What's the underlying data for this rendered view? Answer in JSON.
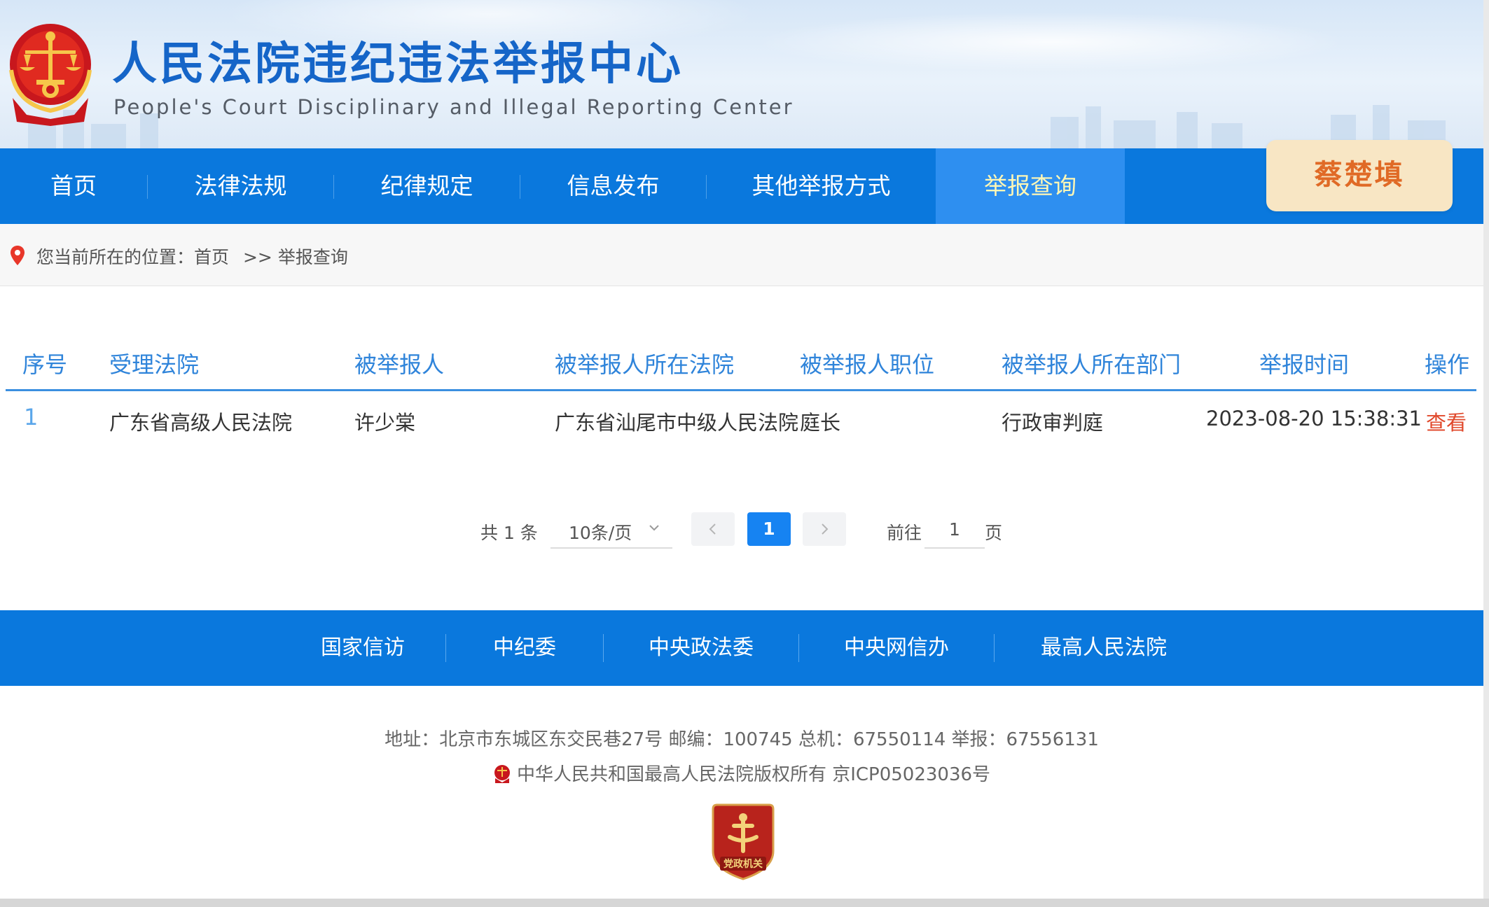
{
  "header": {
    "title_cn": "人民法院违纪违法举报中心",
    "title_en": "People's Court Disciplinary and Illegal Reporting Center"
  },
  "nav": {
    "items": [
      {
        "label": "首页"
      },
      {
        "label": "法律法规"
      },
      {
        "label": "纪律规定"
      },
      {
        "label": "信息发布"
      },
      {
        "label": "其他举报方式"
      },
      {
        "label": "举报查询",
        "active": true
      }
    ],
    "user_name": "蔡楚填"
  },
  "breadcrumb": {
    "prefix": "您当前所在的位置：",
    "home": "首页",
    "separator": ">>",
    "current": "举报查询"
  },
  "table": {
    "headers": [
      "序号",
      "受理法院",
      "被举报人",
      "被举报人所在法院",
      "被举报人职位",
      "被举报人所在部门",
      "举报时间",
      "操作"
    ],
    "rows": [
      {
        "index": "1",
        "court": "广东省高级人民法院",
        "reported_person": "许少棠",
        "reported_court": "广东省汕尾市中级人民法院",
        "position": "庭长",
        "department": "行政审判庭",
        "time": "2023-08-20 15:38:31",
        "action": "查看"
      }
    ]
  },
  "pagination": {
    "total_text": "共 1 条",
    "page_size": "10条/页",
    "current_page": "1",
    "goto_prefix": "前往",
    "goto_value": "1",
    "goto_suffix": "页"
  },
  "footer_nav": {
    "items": [
      "国家信访",
      "中纪委",
      "中央政法委",
      "中央网信办",
      "最高人民法院"
    ]
  },
  "footer": {
    "address": "地址：北京市东城区东交民巷27号 邮编：100745 总机：67550114 举报：67556131",
    "copyright": "中华人民共和国最高人民法院版权所有 京ICP05023036号",
    "badge_text": "党政机关"
  },
  "colors": {
    "primary_blue": "#0a78dd",
    "active_tab": "#2e8ff0",
    "title_blue": "#1565c8",
    "action_red": "#e0472a",
    "user_badge_bg": "#f8e6c4",
    "user_badge_text": "#e06a26"
  },
  "icons": [
    "court-emblem-icon",
    "location-pin-icon",
    "chevron-down-icon",
    "chevron-left-icon",
    "chevron-right-icon",
    "party-government-badge-icon"
  ]
}
